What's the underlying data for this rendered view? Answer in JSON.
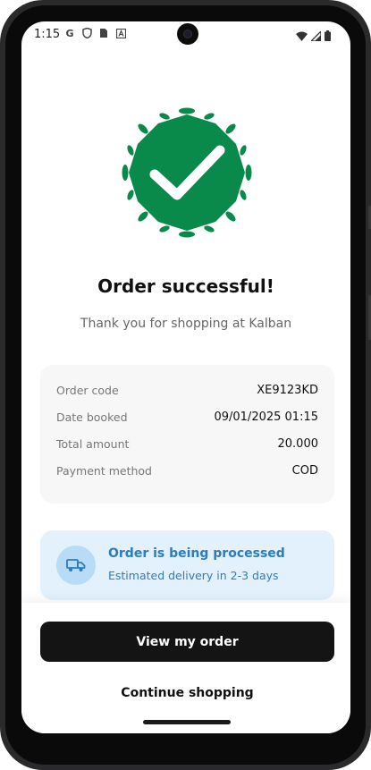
{
  "status_bar": {
    "time": "1:15",
    "left_icons": [
      "google-icon",
      "shield-icon",
      "sim-icon",
      "a-icon"
    ],
    "right_icons": [
      "wifi-icon",
      "signal-icon",
      "battery-icon"
    ]
  },
  "success": {
    "icon": "checkmark-badge-icon",
    "color": "#0a8a4a",
    "title": "Order successful!",
    "subtitle": "Thank you for shopping at Kalban"
  },
  "order_details": [
    {
      "label": "Order code",
      "value": "XE9123KD"
    },
    {
      "label": "Date booked",
      "value": "09/01/2025 01:15"
    },
    {
      "label": "Total amount",
      "value": "20.000"
    },
    {
      "label": "Payment method",
      "value": "COD"
    }
  ],
  "processing": {
    "icon": "truck-icon",
    "title": "Order is being processed",
    "subtitle": "Estimated delivery in 2-3 days",
    "color": "#2d7cc1"
  },
  "actions": {
    "primary_label": "View my order",
    "secondary_label": "Continue shopping"
  }
}
